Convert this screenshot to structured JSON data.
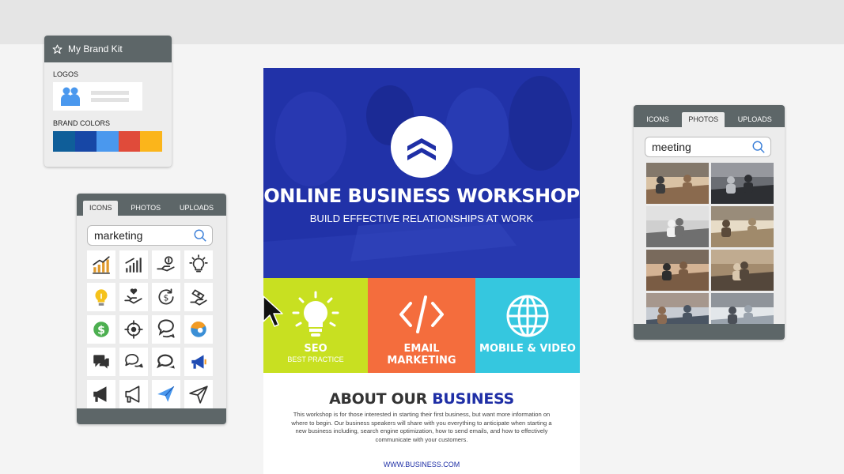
{
  "brand_kit": {
    "title": "My Brand Kit",
    "logos_label": "LOGOS",
    "colors_label": "BRAND COLORS",
    "colors": [
      "#0f5e99",
      "#1747a6",
      "#4a98ee",
      "#e04b3a",
      "#fbb51b"
    ]
  },
  "icons_panel": {
    "tabs": [
      {
        "label": "ICONS",
        "active": true
      },
      {
        "label": "PHOTOS",
        "active": false
      },
      {
        "label": "UPLOADS",
        "active": false
      }
    ],
    "search_value": "marketing",
    "icons": [
      "growth-chart-icon",
      "bar-chart-icon",
      "money-hand-icon",
      "lightbulb-outline-icon",
      "lightbulb-color-icon",
      "hand-heart-icon",
      "dollar-refresh-icon",
      "hand-money-icon",
      "dollar-coin-icon",
      "target-icon",
      "speech-bubble-icon",
      "speaker-avatar-icon",
      "chat-bubbles-icon",
      "chat-bubbles-outline-icon",
      "chat-bubbles-dots-icon",
      "megaphone-color-icon",
      "megaphone-icon",
      "megaphone-outline-icon",
      "paper-plane-color-icon",
      "paper-plane-icon"
    ]
  },
  "photos_panel": {
    "tabs": [
      {
        "label": "ICONS",
        "active": false
      },
      {
        "label": "PHOTOS",
        "active": true
      },
      {
        "label": "UPLOADS",
        "active": false
      }
    ],
    "search_value": "meeting",
    "photo_count": 8
  },
  "flyer": {
    "title": "ONLINE BUSINESS WORKSHOP",
    "subtitle": "BUILD EFFECTIVE RELATIONSHIPS AT WORK",
    "tiles": [
      {
        "label": "SEO",
        "sub": "BEST PRACTICE",
        "color": "#c8e021",
        "icon": "lightbulb-icon"
      },
      {
        "label": "EMAIL MARKETING",
        "sub": "",
        "color": "#f46d3d",
        "icon": "code-icon"
      },
      {
        "label": "MOBILE & VIDEO",
        "sub": "",
        "color": "#35c7df",
        "icon": "globe-icon"
      }
    ],
    "about_heading_part1": "ABOUT OUR",
    "about_heading_part2": "BUSINESS",
    "body": "This workshop is for those interested in starting their first business, but want more information on where to begin. Our business speakers will share with you everything to anticipate when starting a new business including, search engine optimization, how to send emails, and how to effectively communicate with your customers.",
    "website": "WWW.BUSINESS.COM",
    "hero_color": "#1f2fa6"
  }
}
